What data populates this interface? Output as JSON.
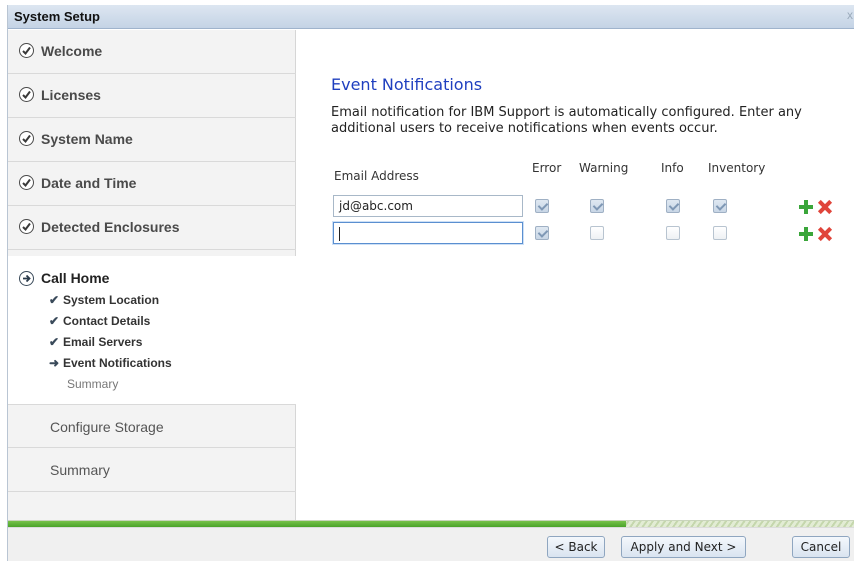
{
  "window": {
    "title": "System Setup"
  },
  "sidebar": {
    "completed_steps": [
      {
        "label": "Welcome"
      },
      {
        "label": "Licenses"
      },
      {
        "label": "System Name"
      },
      {
        "label": "Date and Time"
      },
      {
        "label": "Detected Enclosures"
      }
    ],
    "current_step": {
      "label": "Call Home",
      "substeps": [
        {
          "label": "System Location",
          "state": "done"
        },
        {
          "label": "Contact Details",
          "state": "done"
        },
        {
          "label": "Email Servers",
          "state": "done"
        },
        {
          "label": "Event Notifications",
          "state": "current"
        },
        {
          "label": "Summary",
          "state": "pending"
        }
      ]
    },
    "upcoming_steps": [
      {
        "label": "Configure Storage"
      },
      {
        "label": "Summary"
      }
    ]
  },
  "main": {
    "heading": "Event Notifications",
    "description": "Email notification for IBM Support is automatically configured. Enter any additional users to receive notifications when events occur.",
    "columns": {
      "email": "Email Address",
      "error": "Error",
      "warning": "Warning",
      "info": "Info",
      "inventory": "Inventory"
    },
    "rows": [
      {
        "email": "jd@abc.com",
        "error": true,
        "warning": true,
        "info": true,
        "inventory": true
      },
      {
        "email": "",
        "error": true,
        "warning": false,
        "info": false,
        "inventory": false
      }
    ]
  },
  "progress": {
    "fraction": 0.73
  },
  "footer": {
    "back": "< Back",
    "apply_next": "Apply and Next >",
    "cancel": "Cancel"
  },
  "icons": {
    "completed": "check-circle-icon",
    "current": "arrow-circle-icon",
    "add": "plus-icon",
    "delete": "x-icon"
  }
}
